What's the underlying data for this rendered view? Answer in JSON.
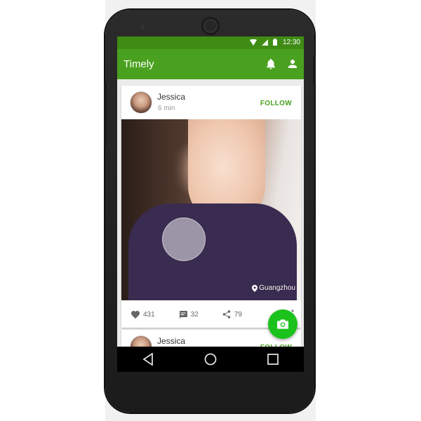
{
  "status_bar": {
    "time": "12:30"
  },
  "app_bar": {
    "title": "Timely"
  },
  "posts": [
    {
      "author": "Jessica",
      "time_ago": "6 min",
      "follow_label": "FOLLOW",
      "location": "Guangzhou",
      "likes": "431",
      "comments": "32",
      "shares": "79"
    },
    {
      "author": "Jessica",
      "follow_label": "FOLLOW"
    }
  ],
  "colors": {
    "status_bar": "#3f8c15",
    "app_bar": "#4aa11f",
    "fab": "#1cc21c",
    "accent_text": "#4aa11f"
  },
  "icons": [
    "wifi-icon",
    "signal-icon",
    "battery-icon",
    "bell-icon",
    "profile-icon",
    "location-pin-icon",
    "heart-icon",
    "comment-icon",
    "share-icon",
    "more-vert-icon",
    "camera-icon",
    "back-icon",
    "home-icon",
    "recents-icon"
  ]
}
